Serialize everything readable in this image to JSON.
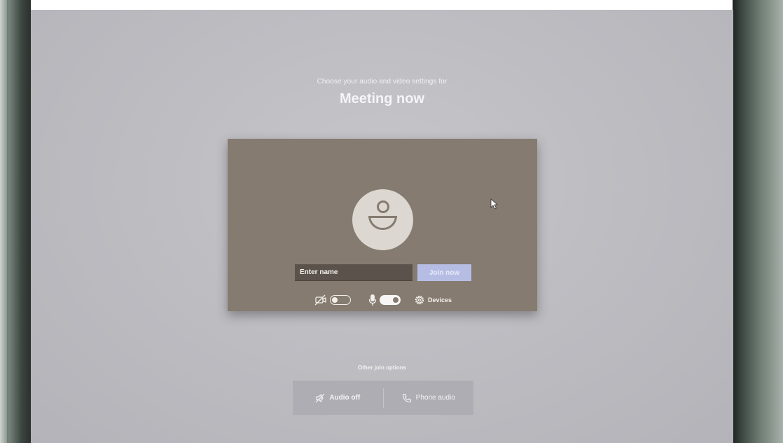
{
  "prejoin": {
    "subtitle": "Choose your audio and video settings for",
    "meeting_title": "Meeting now",
    "name_placeholder": "Enter name",
    "join_label": "Join now",
    "devices_label": "Devices",
    "camera_on": false,
    "mic_on": true
  },
  "other_options": {
    "label": "Other join options",
    "audio_off_label": "Audio off",
    "phone_audio_label": "Phone audio"
  },
  "icons": {
    "camera": "camera-off-icon",
    "mic": "microphone-icon",
    "devices": "gear-icon",
    "audio_off": "speaker-off-icon",
    "phone": "phone-icon",
    "avatar": "person-icon"
  },
  "colors": {
    "preview_bg": "#857b70",
    "join_button": "#b6bde4",
    "screen_bg": "#bdbdc2"
  }
}
